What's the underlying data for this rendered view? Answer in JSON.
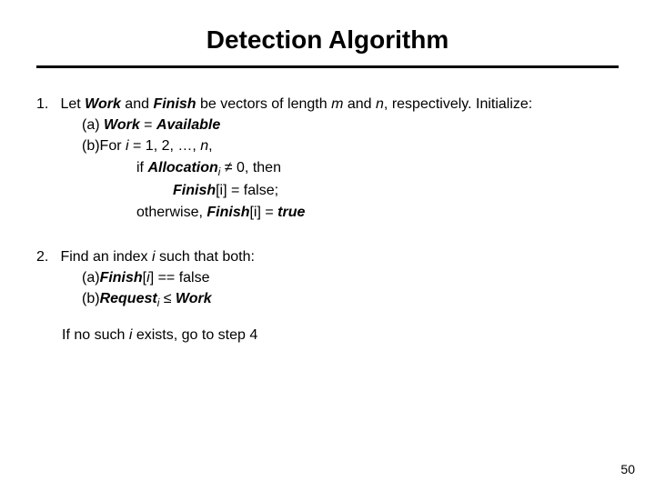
{
  "title": "Detection Algorithm",
  "step1": {
    "num": "1.",
    "lead1": "Let ",
    "work": "Work",
    "lead2": " and ",
    "finish": "Finish",
    "lead3": " be vectors of length ",
    "m": "m",
    "lead4": " and ",
    "n": "n",
    "lead5": ", respectively. Initialize:",
    "a_label": "(a) ",
    "a_work": "Work",
    "a_eq": " = ",
    "a_avail": "Available",
    "b_label": "(b)For ",
    "b_i": "i",
    "b_range1": " = 1, 2, …, ",
    "b_n": "n",
    "b_range2": ",",
    "if1": "if ",
    "alloc": "Allocation",
    "alloc_sub": "i",
    "if2": " ≠ 0, then",
    "then1a": "Finish",
    "then1b": "[i] = false;",
    "else1": "otherwise, ",
    "else_fin": "Finish",
    "else2": "[i] = ",
    "else_true": "true"
  },
  "step2": {
    "num": "2.",
    "lead1": "Find an index ",
    "i": "i",
    "lead2": " such that both:",
    "a_label": "(a)",
    "a_fin": "Finish",
    "a_rest": "[",
    "a_i": "i",
    "a_rest2": "] == false",
    "b_label": "(b)",
    "b_req": "Request",
    "b_sub": "i",
    "b_le": " ≤ ",
    "b_work": "Work",
    "tail1": "If no such ",
    "tail_i": "i",
    "tail2": " exists, go to step 4"
  },
  "page": "50"
}
